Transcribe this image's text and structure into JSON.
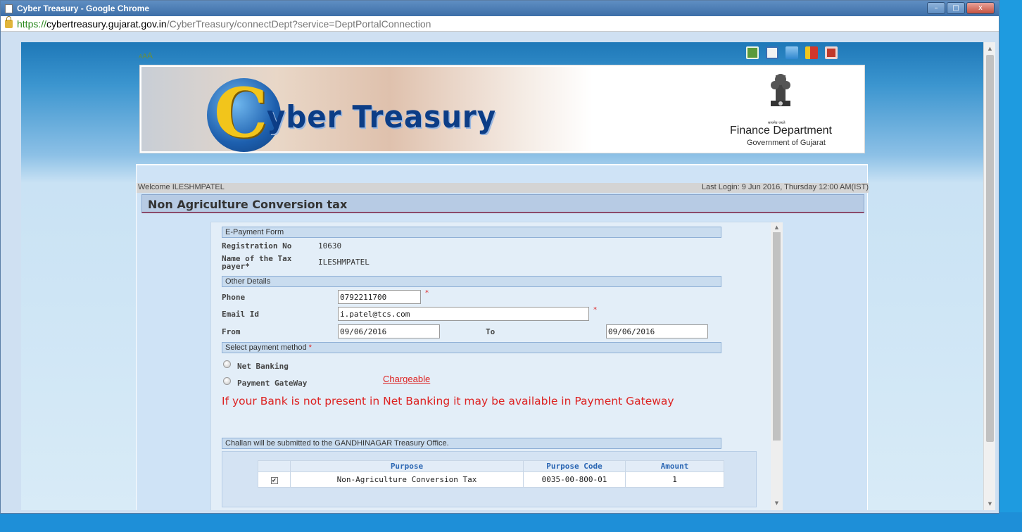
{
  "window": {
    "title": "Cyber Treasury - Google Chrome",
    "controls": {
      "minimize": "–",
      "maximize": "□",
      "close": "x"
    }
  },
  "address": {
    "scheme": "https://",
    "domain": "cybertreasury.gujarat.gov.in",
    "path": "/CyberTreasury/connectDept?service=DeptPortalConnection"
  },
  "font_controls": {
    "small": "A",
    "medium": "A",
    "large": "A"
  },
  "top_icons": [
    {
      "name": "phone-icon",
      "color": "#5a9a3a"
    },
    {
      "name": "edit-icon",
      "color": "#3a6fb3"
    },
    {
      "name": "download-icon",
      "color": "#2f87cf"
    },
    {
      "name": "help-icon",
      "color": "#d1372b"
    },
    {
      "name": "exit-icon",
      "color": "#c0392b"
    }
  ],
  "banner": {
    "logo_letter": "C",
    "logo_rest": "yber Treasury",
    "emblem_caption": "सत्यमेव जयते",
    "department": "Finance Department",
    "government": "Government of Gujarat"
  },
  "user": {
    "welcome": "Welcome ILESHMPATEL",
    "last_login": "Last Login: 9 Jun 2016, Thursday 12:00 AM(IST)"
  },
  "page_title": "Non Agriculture Conversion tax",
  "form": {
    "epayment_header": "E-Payment Form",
    "registration_label": "Registration No",
    "registration_value": "10630",
    "taxpayer_label_1": "Name of the Tax",
    "taxpayer_label_2": "payer*",
    "taxpayer_value": "ILESHMPATEL",
    "other_details_header": "Other Details",
    "phone_label": "Phone",
    "phone_value": "0792211700",
    "email_label": "Email Id",
    "email_value": "i.patel@tcs.com",
    "from_label": "From",
    "from_value": "09/06/2016",
    "to_label": "To",
    "to_value": "09/06/2016",
    "required_mark": "*",
    "payment_method_header": "Select payment method",
    "net_banking_label": "Net Banking",
    "payment_gateway_label": "Payment GateWay",
    "chargeable_label": "Chargeable",
    "bank_note": "If your Bank is not present in Net Banking it may be available in Payment Gateway",
    "challan_header": "Challan will be submitted to the GANDHINAGAR Treasury Office."
  },
  "purpose_table": {
    "columns": [
      "",
      "Purpose",
      "Purpose Code",
      "Amount"
    ],
    "rows": [
      {
        "checked": "✔",
        "purpose": "Non-Agriculture Conversion Tax",
        "code": "0035-00-800-01",
        "amount": "1"
      }
    ]
  }
}
